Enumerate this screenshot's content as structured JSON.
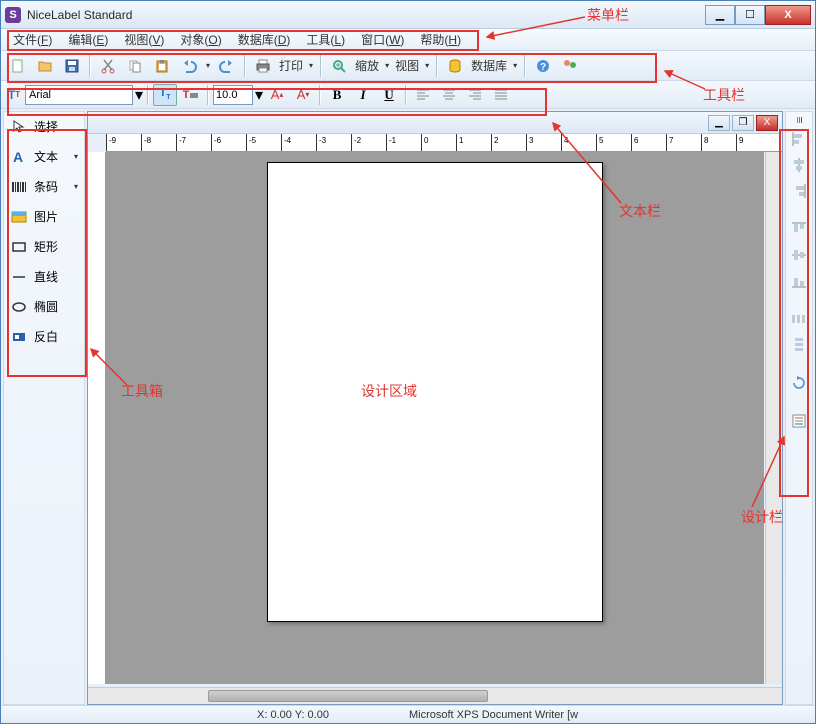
{
  "app": {
    "title": "NiceLabel Standard"
  },
  "win_controls": {
    "min": "▁",
    "max": "☐",
    "close": "X"
  },
  "menubar": [
    {
      "label": "文件",
      "key": "F"
    },
    {
      "label": "编辑",
      "key": "E"
    },
    {
      "label": "视图",
      "key": "V"
    },
    {
      "label": "对象",
      "key": "O"
    },
    {
      "label": "数据库",
      "key": "D"
    },
    {
      "label": "工具",
      "key": "L"
    },
    {
      "label": "窗口",
      "key": "W"
    },
    {
      "label": "帮助",
      "key": "H"
    }
  ],
  "toolbar": {
    "print_label": "打印",
    "zoom_label": "缩放",
    "view_label": "视图",
    "database_label": "数据库"
  },
  "text_toolbar": {
    "font": "Arial",
    "size": "10.0",
    "bold": "B",
    "italic": "I",
    "underline": "U"
  },
  "toolbox": [
    {
      "label": "选择",
      "dd": false
    },
    {
      "label": "文本",
      "dd": true
    },
    {
      "label": "条码",
      "dd": true
    },
    {
      "label": "图片",
      "dd": false
    },
    {
      "label": "矩形",
      "dd": false
    },
    {
      "label": "直线",
      "dd": false
    },
    {
      "label": "椭圆",
      "dd": false
    },
    {
      "label": "反白",
      "dd": false
    }
  ],
  "statusbar": {
    "coord": "X: 0.00 Y: 0.00",
    "printer": "Microsoft XPS Document Writer [w"
  },
  "annotations": {
    "menubar": "菜单栏",
    "toolbar": "工具栏",
    "textbar": "文本栏",
    "toolbox": "工具箱",
    "design_area": "设计区域",
    "design_bar": "设计栏"
  },
  "ruler_ticks": [
    "-9",
    "-8",
    "-7",
    "-6",
    "-5",
    "-4",
    "-3",
    "-2",
    "-1",
    "0",
    "1",
    "2",
    "3",
    "4",
    "5",
    "6",
    "7",
    "8",
    "9"
  ]
}
